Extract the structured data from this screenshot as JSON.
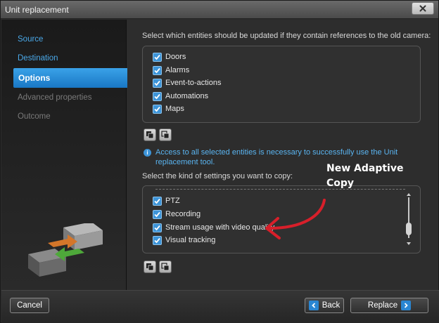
{
  "window": {
    "title": "Unit replacement"
  },
  "sidebar": {
    "items": [
      {
        "label": "Source",
        "state": "link"
      },
      {
        "label": "Destination",
        "state": "link"
      },
      {
        "label": "Options",
        "state": "active"
      },
      {
        "label": "Advanced properties",
        "state": "disabled"
      },
      {
        "label": "Outcome",
        "state": "disabled"
      }
    ]
  },
  "options": {
    "entities_heading": "Select which entities should be updated if they contain references to the old camera:",
    "entities": [
      {
        "label": "Doors",
        "checked": true
      },
      {
        "label": "Alarms",
        "checked": true
      },
      {
        "label": "Event-to-actions",
        "checked": true
      },
      {
        "label": "Automations",
        "checked": true
      },
      {
        "label": "Maps",
        "checked": true
      }
    ],
    "info_text": "Access to all selected entities is necessary to successfully use the Unit replacement tool.",
    "settings_heading": "Select the kind of settings you want to copy:",
    "settings": [
      {
        "label": "PTZ",
        "checked": true
      },
      {
        "label": "Recording",
        "checked": true
      },
      {
        "label": "Stream usage with video quality",
        "checked": true
      },
      {
        "label": "Visual tracking",
        "checked": true
      }
    ]
  },
  "annotation": {
    "text": "New Adaptive Copy"
  },
  "footer": {
    "cancel_label": "Cancel",
    "back_label": "Back",
    "replace_label": "Replace"
  },
  "colors": {
    "accent": "#2a86d2",
    "link": "#4aa8e8",
    "annotation_arrow": "#d81f2a"
  }
}
